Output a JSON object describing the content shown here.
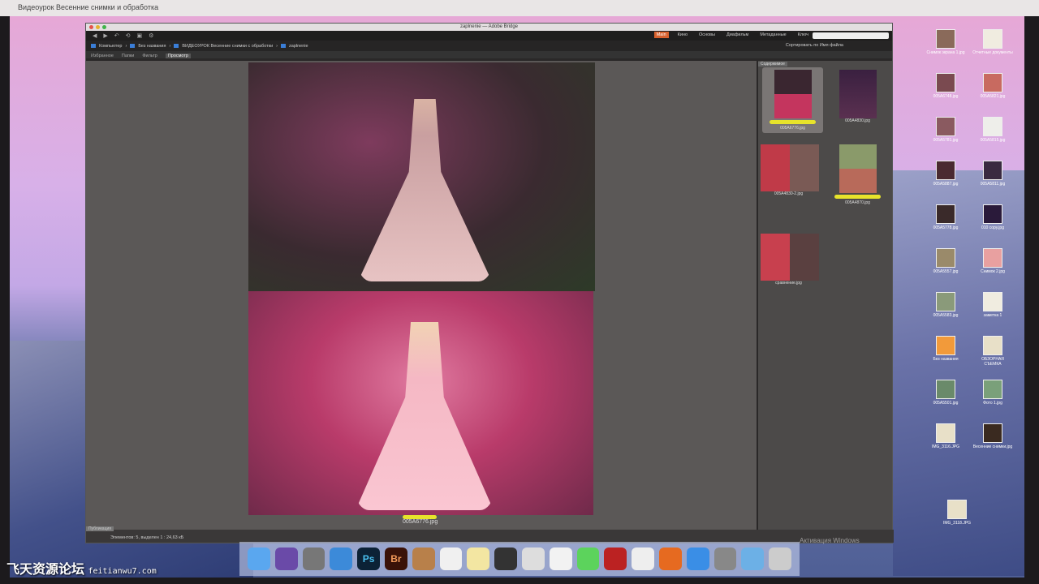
{
  "os_title": "Видеоурок Весенние снимки и обработка",
  "window": {
    "title": "Adobe Bridge",
    "folder": "zaplnenie"
  },
  "workspaces": [
    "Main",
    "Кино",
    "Основы",
    "Диафильм",
    "Метаданные",
    "Ключ"
  ],
  "search_placeholder": "",
  "sort_label": "Сортировать по Имя файла",
  "path": [
    "Компьютер",
    "Без названия",
    "ВИДЕОУРОК Весенние снимки с обработки",
    "zaplnenie"
  ],
  "tabs": [
    "Избранное",
    "Папки",
    "Фильтр",
    "Просмотр"
  ],
  "content_tab": "Содержимое",
  "preview_file": "005A6776.jpg",
  "thumbnails": [
    {
      "name": "005A6776.jpg",
      "label": "yellow",
      "selected": true
    },
    {
      "name": "005A4830.jpg",
      "label": ""
    },
    {
      "name": "005A4830-2.jpg",
      "label": ""
    },
    {
      "name": "005A4870.jpg",
      "label": "yellow"
    },
    {
      "name": "сравнение.jpg",
      "label": ""
    }
  ],
  "status_tab": "Публикация",
  "status": "Элементов: 5, выделен 1 : 24,63 кБ",
  "desktop_icons": [
    "Снимок экрана 1.jpg",
    "Отчетные документы",
    "005A6748.jpg",
    "005A5821.jpg",
    "005A5781.jpg",
    "005A5815.jpg",
    "005A5887.jpg",
    "005A5811.jpg",
    "005A5778.jpg",
    "010 copy.jpg",
    "005A5557.jpg",
    "Снимок 2.jpg",
    "005A5583.jpg",
    "заметка 1",
    "Без названия",
    "ОБЗОРНАЯ СЪЕМКА",
    "005A5501.jpg",
    "Фото 1.jpg",
    "IMG_3116.JPG",
    "Весенние снимки.jpg",
    "IMG_3118.JPG"
  ],
  "dock": [
    {
      "icon": "finder-icon",
      "c": "#5aa7ef",
      "t": ""
    },
    {
      "icon": "siri-icon",
      "c": "#6a4aa8",
      "t": ""
    },
    {
      "icon": "launchpad-icon",
      "c": "#777",
      "t": ""
    },
    {
      "icon": "safari-icon",
      "c": "#3c8ad9",
      "t": ""
    },
    {
      "icon": "photoshop-icon",
      "c": "#0c2236",
      "t": "Ps"
    },
    {
      "icon": "bridge-icon",
      "c": "#3a1208",
      "t": "Br"
    },
    {
      "icon": "notes-icon",
      "c": "#b8804a",
      "t": ""
    },
    {
      "icon": "calendar-icon",
      "c": "#f0f0f0",
      "t": ""
    },
    {
      "icon": "stickies-icon",
      "c": "#f3e6a2",
      "t": ""
    },
    {
      "icon": "quicktime-icon",
      "c": "#333",
      "t": ""
    },
    {
      "icon": "preview-icon",
      "c": "#ddd",
      "t": ""
    },
    {
      "icon": "photos-icon",
      "c": "#f2f2f2",
      "t": ""
    },
    {
      "icon": "messages-icon",
      "c": "#5cd35c",
      "t": ""
    },
    {
      "icon": "photobooth-icon",
      "c": "#b22",
      "t": ""
    },
    {
      "icon": "itunes-icon",
      "c": "#eee",
      "t": ""
    },
    {
      "icon": "ibooks-icon",
      "c": "#e66a20",
      "t": ""
    },
    {
      "icon": "appstore-icon",
      "c": "#3a8ee6",
      "t": ""
    },
    {
      "icon": "settings-icon",
      "c": "#888",
      "t": ""
    },
    {
      "icon": "downloads-icon",
      "c": "#6cb0e6",
      "t": ""
    },
    {
      "icon": "trash-icon",
      "c": "#ccc",
      "t": ""
    }
  ],
  "watermark": {
    "cn": "飞天资源论坛",
    "url": "feitianwu7.com"
  },
  "activation": "Активация Windows"
}
